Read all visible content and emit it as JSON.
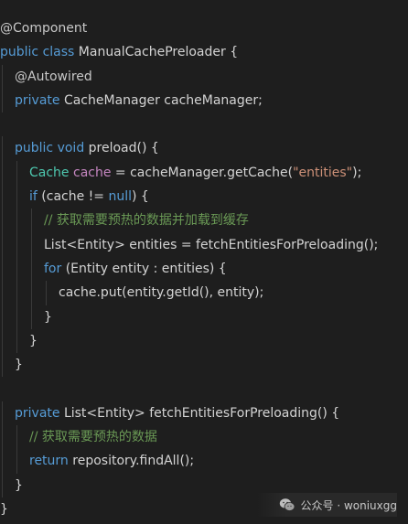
{
  "colors": {
    "background": "#1e1e1e",
    "default": "#d4d4d4",
    "keyword": "#569cd6",
    "type": "#4ec9b0",
    "variable": "#c586c0",
    "string": "#ce9178",
    "comment": "#6a9955",
    "annotation": "#c8c8c8"
  },
  "code_lines": [
    {
      "indent": 0,
      "tokens": [
        {
          "t": "@Component",
          "c": "annotation"
        }
      ]
    },
    {
      "indent": 0,
      "tokens": [
        {
          "t": "public class ",
          "c": "keyword"
        },
        {
          "t": "ManualCachePreloader {",
          "c": "default"
        }
      ]
    },
    {
      "indent": 1,
      "tokens": [
        {
          "t": "@Autowired",
          "c": "annotation"
        }
      ]
    },
    {
      "indent": 1,
      "tokens": [
        {
          "t": "private ",
          "c": "keyword"
        },
        {
          "t": "CacheManager cacheManager;",
          "c": "default"
        }
      ]
    },
    {
      "indent": 0,
      "tokens": []
    },
    {
      "indent": 1,
      "tokens": [
        {
          "t": "public void ",
          "c": "keyword"
        },
        {
          "t": "preload() {",
          "c": "default"
        }
      ]
    },
    {
      "indent": 2,
      "tokens": [
        {
          "t": "Cache ",
          "c": "type"
        },
        {
          "t": "cache",
          "c": "variable"
        },
        {
          "t": " = cacheManager.getCache(",
          "c": "default"
        },
        {
          "t": "\"entities\"",
          "c": "string"
        },
        {
          "t": ");",
          "c": "default"
        }
      ]
    },
    {
      "indent": 2,
      "tokens": [
        {
          "t": "if ",
          "c": "keyword"
        },
        {
          "t": "(cache != ",
          "c": "default"
        },
        {
          "t": "null",
          "c": "keyword"
        },
        {
          "t": ") {",
          "c": "default"
        }
      ]
    },
    {
      "indent": 3,
      "tokens": [
        {
          "t": "// 获取需要预热的数据并加载到缓存",
          "c": "comment"
        }
      ]
    },
    {
      "indent": 3,
      "tokens": [
        {
          "t": "List<Entity> entities = fetchEntitiesForPreloading();",
          "c": "default"
        }
      ]
    },
    {
      "indent": 3,
      "tokens": [
        {
          "t": "for ",
          "c": "keyword"
        },
        {
          "t": "(Entity entity : entities) {",
          "c": "default"
        }
      ]
    },
    {
      "indent": 4,
      "tokens": [
        {
          "t": "cache.put(entity.getId(), entity);",
          "c": "default"
        }
      ]
    },
    {
      "indent": 3,
      "tokens": [
        {
          "t": "}",
          "c": "default"
        }
      ]
    },
    {
      "indent": 2,
      "tokens": [
        {
          "t": "}",
          "c": "default"
        }
      ]
    },
    {
      "indent": 1,
      "tokens": [
        {
          "t": "}",
          "c": "default"
        }
      ]
    },
    {
      "indent": 0,
      "tokens": []
    },
    {
      "indent": 1,
      "tokens": [
        {
          "t": "private ",
          "c": "keyword"
        },
        {
          "t": "List<Entity> fetchEntitiesForPreloading() {",
          "c": "default"
        }
      ]
    },
    {
      "indent": 2,
      "tokens": [
        {
          "t": "// 获取需要预热的数据",
          "c": "comment"
        }
      ]
    },
    {
      "indent": 2,
      "tokens": [
        {
          "t": "return ",
          "c": "keyword"
        },
        {
          "t": "repository.findAll();",
          "c": "default"
        }
      ]
    },
    {
      "indent": 1,
      "tokens": [
        {
          "t": "}",
          "c": "default"
        }
      ]
    },
    {
      "indent": 0,
      "tokens": [
        {
          "t": "}",
          "c": "default"
        }
      ]
    }
  ],
  "watermark": {
    "icon": "wechat-icon",
    "text": "公众号 · woniuxgg"
  }
}
